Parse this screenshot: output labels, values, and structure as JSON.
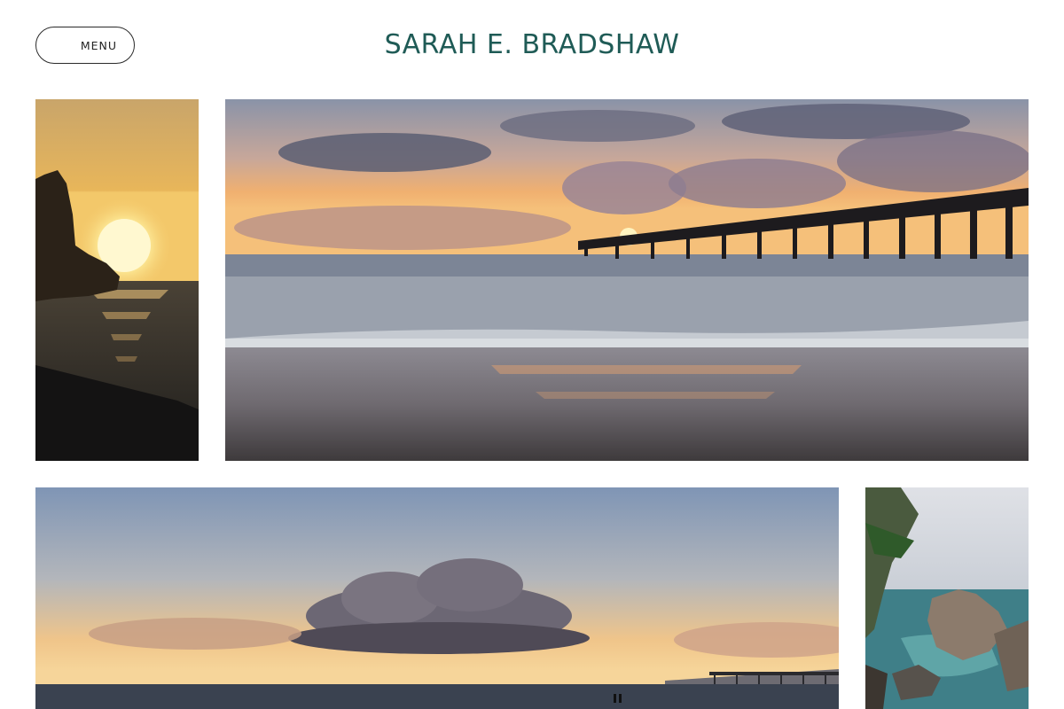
{
  "header": {
    "menu_label": "MENU",
    "site_title": "SARAH E. BRADSHAW"
  },
  "colors": {
    "title": "#1f5b56",
    "menu_border": "#2a2a2a",
    "background": "#ffffff"
  },
  "gallery": {
    "photos": [
      {
        "subject": "sunset over sea beside a rock"
      },
      {
        "subject": "pier at sunset over the beach"
      },
      {
        "subject": "cloud at sunset over the ocean with pier"
      },
      {
        "subject": "rocky coastline with cypress tree"
      }
    ]
  }
}
